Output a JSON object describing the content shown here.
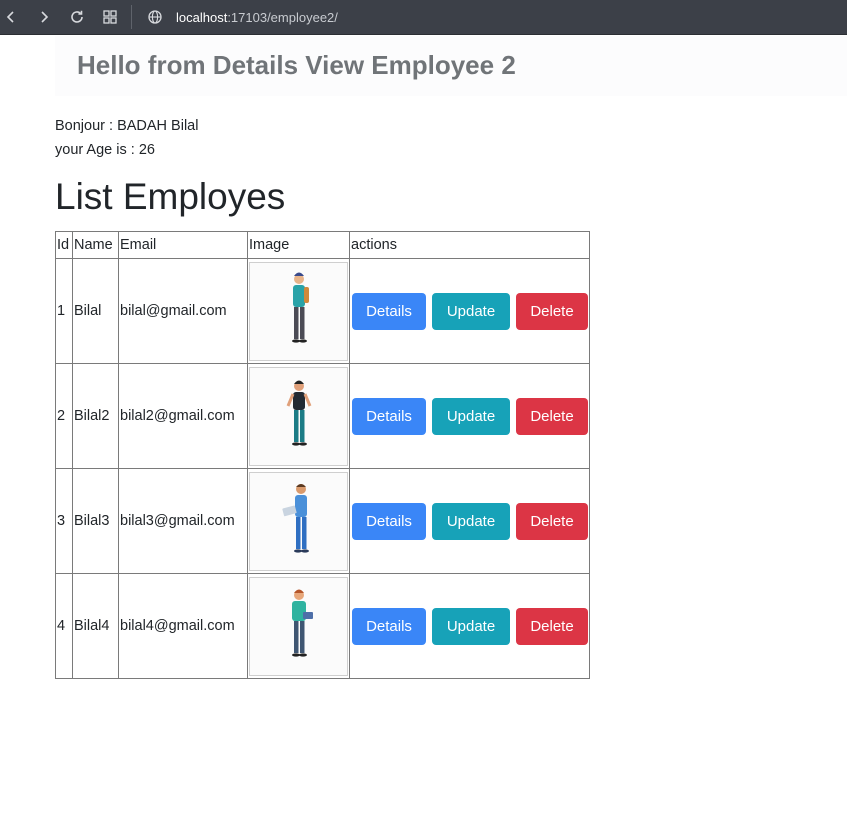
{
  "browser": {
    "url_host": "localhost",
    "url_rest": ":17103/employee2/"
  },
  "header": {
    "title": "Hello from Details View Employee 2"
  },
  "greeting": {
    "bonjour": "Bonjour : BADAH Bilal",
    "age": "your Age is : 26"
  },
  "list_title": "List Employes",
  "table": {
    "columns": [
      "Id",
      "Name",
      "Email",
      "Image",
      "actions"
    ],
    "rows": [
      {
        "id": "1",
        "name": "Bilal",
        "email": "bilal@gmail.com"
      },
      {
        "id": "2",
        "name": "Bilal2",
        "email": "bilal2@gmail.com"
      },
      {
        "id": "3",
        "name": "Bilal3",
        "email": "bilal3@gmail.com"
      },
      {
        "id": "4",
        "name": "Bilal4",
        "email": "bilal4@gmail.com"
      }
    ],
    "buttons": {
      "details": "Details",
      "update": "Update",
      "delete": "Delete"
    }
  },
  "colors": {
    "details": "#3a86f7",
    "update": "#17a2b8",
    "delete": "#dc3545"
  }
}
